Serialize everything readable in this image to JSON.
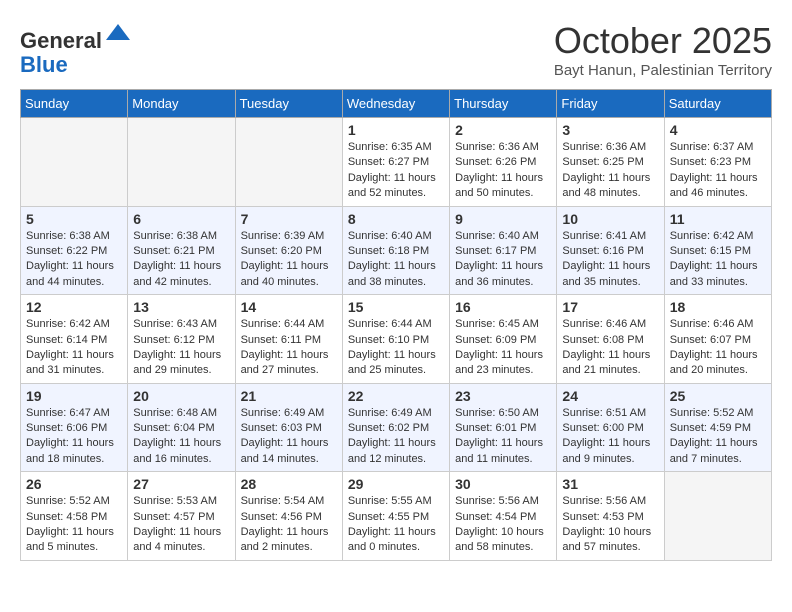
{
  "header": {
    "logo_general": "General",
    "logo_blue": "Blue",
    "month_title": "October 2025",
    "location": "Bayt Hanun, Palestinian Territory"
  },
  "days_of_week": [
    "Sunday",
    "Monday",
    "Tuesday",
    "Wednesday",
    "Thursday",
    "Friday",
    "Saturday"
  ],
  "weeks": [
    {
      "alt": false,
      "days": [
        {
          "number": "",
          "info": ""
        },
        {
          "number": "",
          "info": ""
        },
        {
          "number": "",
          "info": ""
        },
        {
          "number": "1",
          "info": "Sunrise: 6:35 AM\nSunset: 6:27 PM\nDaylight: 11 hours and 52 minutes."
        },
        {
          "number": "2",
          "info": "Sunrise: 6:36 AM\nSunset: 6:26 PM\nDaylight: 11 hours and 50 minutes."
        },
        {
          "number": "3",
          "info": "Sunrise: 6:36 AM\nSunset: 6:25 PM\nDaylight: 11 hours and 48 minutes."
        },
        {
          "number": "4",
          "info": "Sunrise: 6:37 AM\nSunset: 6:23 PM\nDaylight: 11 hours and 46 minutes."
        }
      ]
    },
    {
      "alt": true,
      "days": [
        {
          "number": "5",
          "info": "Sunrise: 6:38 AM\nSunset: 6:22 PM\nDaylight: 11 hours and 44 minutes."
        },
        {
          "number": "6",
          "info": "Sunrise: 6:38 AM\nSunset: 6:21 PM\nDaylight: 11 hours and 42 minutes."
        },
        {
          "number": "7",
          "info": "Sunrise: 6:39 AM\nSunset: 6:20 PM\nDaylight: 11 hours and 40 minutes."
        },
        {
          "number": "8",
          "info": "Sunrise: 6:40 AM\nSunset: 6:18 PM\nDaylight: 11 hours and 38 minutes."
        },
        {
          "number": "9",
          "info": "Sunrise: 6:40 AM\nSunset: 6:17 PM\nDaylight: 11 hours and 36 minutes."
        },
        {
          "number": "10",
          "info": "Sunrise: 6:41 AM\nSunset: 6:16 PM\nDaylight: 11 hours and 35 minutes."
        },
        {
          "number": "11",
          "info": "Sunrise: 6:42 AM\nSunset: 6:15 PM\nDaylight: 11 hours and 33 minutes."
        }
      ]
    },
    {
      "alt": false,
      "days": [
        {
          "number": "12",
          "info": "Sunrise: 6:42 AM\nSunset: 6:14 PM\nDaylight: 11 hours and 31 minutes."
        },
        {
          "number": "13",
          "info": "Sunrise: 6:43 AM\nSunset: 6:12 PM\nDaylight: 11 hours and 29 minutes."
        },
        {
          "number": "14",
          "info": "Sunrise: 6:44 AM\nSunset: 6:11 PM\nDaylight: 11 hours and 27 minutes."
        },
        {
          "number": "15",
          "info": "Sunrise: 6:44 AM\nSunset: 6:10 PM\nDaylight: 11 hours and 25 minutes."
        },
        {
          "number": "16",
          "info": "Sunrise: 6:45 AM\nSunset: 6:09 PM\nDaylight: 11 hours and 23 minutes."
        },
        {
          "number": "17",
          "info": "Sunrise: 6:46 AM\nSunset: 6:08 PM\nDaylight: 11 hours and 21 minutes."
        },
        {
          "number": "18",
          "info": "Sunrise: 6:46 AM\nSunset: 6:07 PM\nDaylight: 11 hours and 20 minutes."
        }
      ]
    },
    {
      "alt": true,
      "days": [
        {
          "number": "19",
          "info": "Sunrise: 6:47 AM\nSunset: 6:06 PM\nDaylight: 11 hours and 18 minutes."
        },
        {
          "number": "20",
          "info": "Sunrise: 6:48 AM\nSunset: 6:04 PM\nDaylight: 11 hours and 16 minutes."
        },
        {
          "number": "21",
          "info": "Sunrise: 6:49 AM\nSunset: 6:03 PM\nDaylight: 11 hours and 14 minutes."
        },
        {
          "number": "22",
          "info": "Sunrise: 6:49 AM\nSunset: 6:02 PM\nDaylight: 11 hours and 12 minutes."
        },
        {
          "number": "23",
          "info": "Sunrise: 6:50 AM\nSunset: 6:01 PM\nDaylight: 11 hours and 11 minutes."
        },
        {
          "number": "24",
          "info": "Sunrise: 6:51 AM\nSunset: 6:00 PM\nDaylight: 11 hours and 9 minutes."
        },
        {
          "number": "25",
          "info": "Sunrise: 5:52 AM\nSunset: 4:59 PM\nDaylight: 11 hours and 7 minutes."
        }
      ]
    },
    {
      "alt": false,
      "days": [
        {
          "number": "26",
          "info": "Sunrise: 5:52 AM\nSunset: 4:58 PM\nDaylight: 11 hours and 5 minutes."
        },
        {
          "number": "27",
          "info": "Sunrise: 5:53 AM\nSunset: 4:57 PM\nDaylight: 11 hours and 4 minutes."
        },
        {
          "number": "28",
          "info": "Sunrise: 5:54 AM\nSunset: 4:56 PM\nDaylight: 11 hours and 2 minutes."
        },
        {
          "number": "29",
          "info": "Sunrise: 5:55 AM\nSunset: 4:55 PM\nDaylight: 11 hours and 0 minutes."
        },
        {
          "number": "30",
          "info": "Sunrise: 5:56 AM\nSunset: 4:54 PM\nDaylight: 10 hours and 58 minutes."
        },
        {
          "number": "31",
          "info": "Sunrise: 5:56 AM\nSunset: 4:53 PM\nDaylight: 10 hours and 57 minutes."
        },
        {
          "number": "",
          "info": ""
        }
      ]
    }
  ]
}
